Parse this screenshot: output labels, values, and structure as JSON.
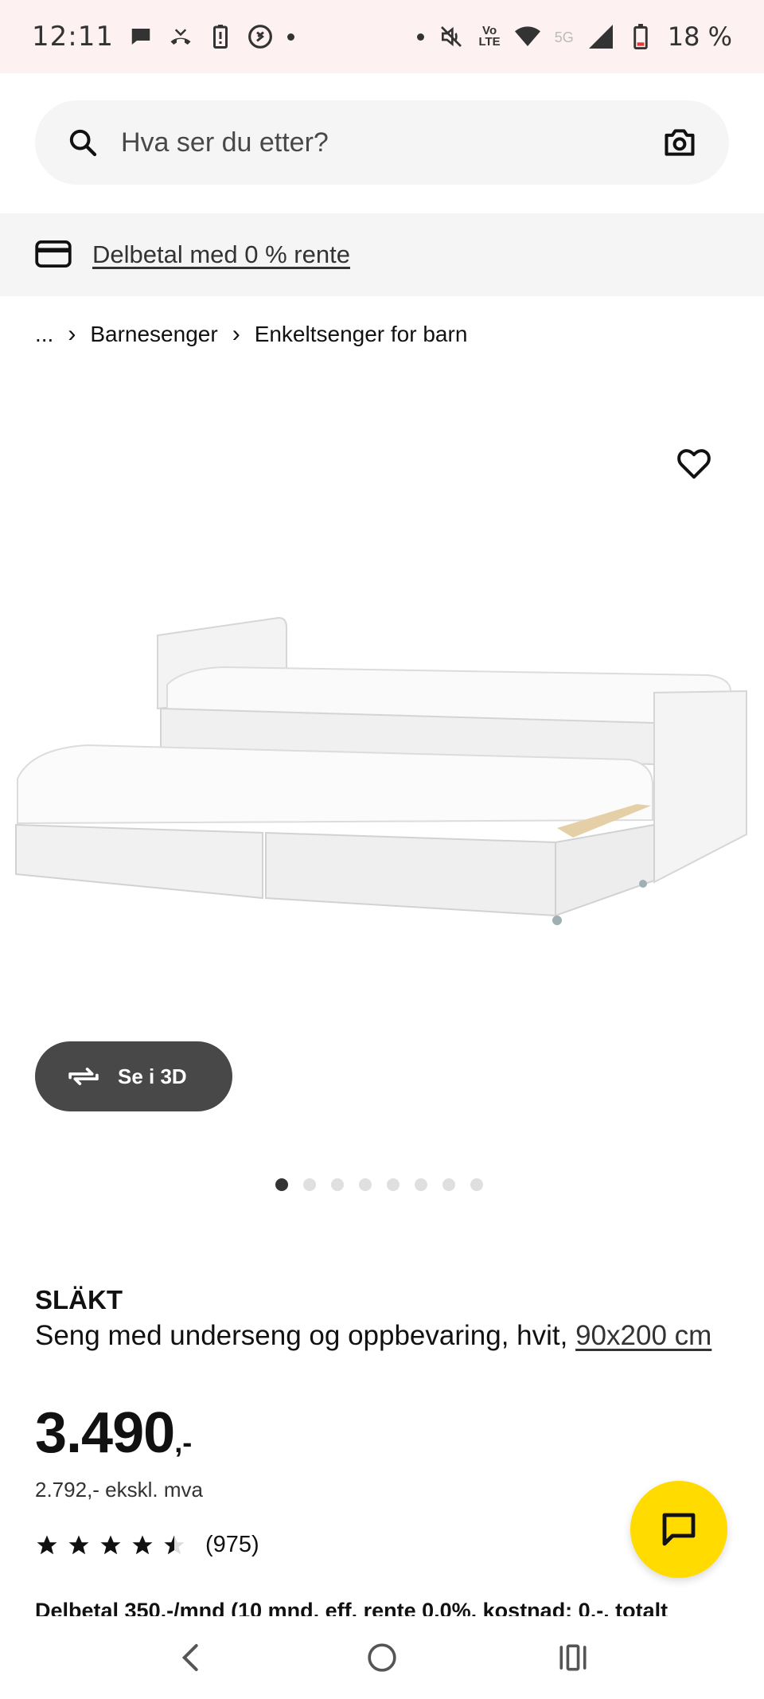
{
  "status_bar": {
    "time": "12:11",
    "network_label": "5G",
    "lte_label_top": "Vo",
    "lte_label_bottom": "LTE",
    "battery": "18 %"
  },
  "search": {
    "placeholder": "Hva ser du etter?",
    "icon": "search-icon",
    "camera_icon": "camera-icon"
  },
  "promo": {
    "icon": "credit-card-icon",
    "link_text": "Delbetal med 0 % rente"
  },
  "breadcrumb": {
    "ellipsis": "...",
    "items": [
      "Barnesenger",
      "Enkeltsenger for barn"
    ]
  },
  "gallery": {
    "see_3d_label": "Se i 3D",
    "image_count": 8,
    "active_index": 0
  },
  "product": {
    "brand": "SLÄKT",
    "description": "Seng med underseng og oppbevaring, hvit, ",
    "size": "90x200 cm",
    "price_int": "3.490",
    "price_suffix": ",-",
    "price_ex_vat": "2.792,- ekskl. mva",
    "rating_value": 4.5,
    "rating_count": "(975)",
    "installment": "Delbetal 350,-/mnd (10 mnd, eff. rente 0,0%, kostnad: 0,-, totalt"
  },
  "colors": {
    "accent_yellow": "#ffdb00",
    "dark_button": "#484848",
    "light_bg": "#f5f5f5"
  }
}
